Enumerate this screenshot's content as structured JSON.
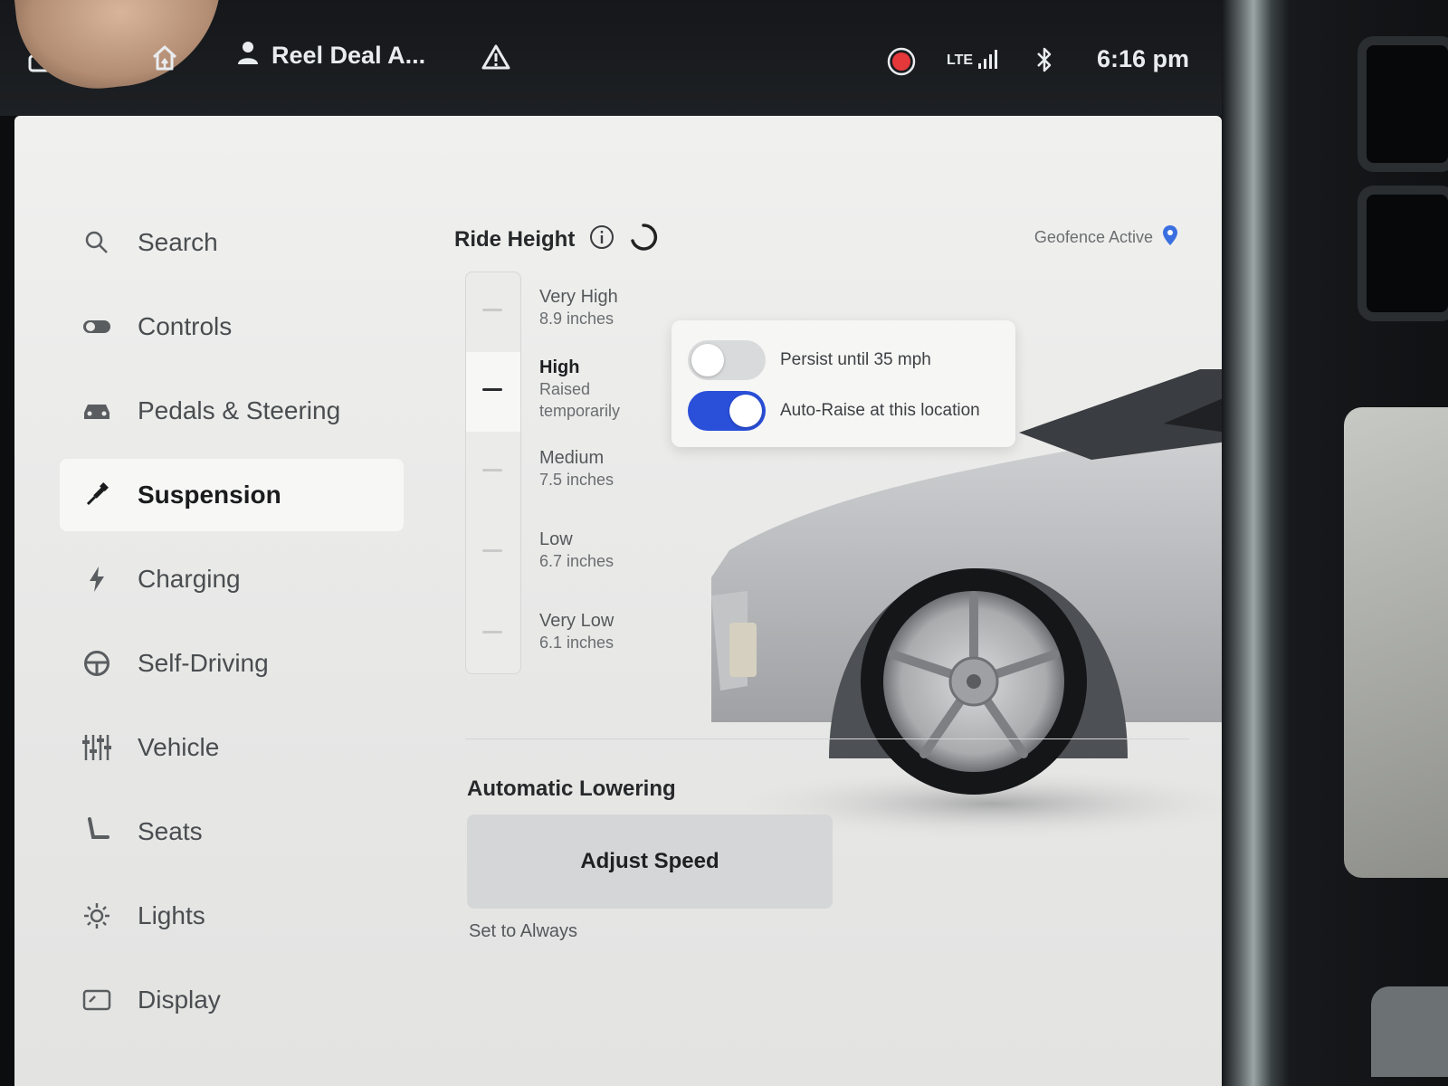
{
  "status_bar": {
    "profile_name": "Reel Deal A...",
    "time": "6:16 pm",
    "network": "LTE"
  },
  "sidebar": {
    "items": [
      {
        "label": "Search",
        "icon": "search-icon"
      },
      {
        "label": "Controls",
        "icon": "toggle-icon"
      },
      {
        "label": "Pedals & Steering",
        "icon": "car-icon"
      },
      {
        "label": "Suspension",
        "icon": "suspension-icon",
        "active": true
      },
      {
        "label": "Charging",
        "icon": "bolt-icon"
      },
      {
        "label": "Self-Driving",
        "icon": "steering-wheel-icon"
      },
      {
        "label": "Vehicle",
        "icon": "sliders-icon"
      },
      {
        "label": "Seats",
        "icon": "seat-icon"
      },
      {
        "label": "Lights",
        "icon": "sun-icon"
      },
      {
        "label": "Display",
        "icon": "display-icon"
      }
    ]
  },
  "ride_height": {
    "title": "Ride Height",
    "geofence_label": "Geofence Active",
    "levels": [
      {
        "name": "Very High",
        "detail": "8.9 inches"
      },
      {
        "name": "High",
        "detail": "Raised",
        "detail2": "temporarily",
        "selected": true
      },
      {
        "name": "Medium",
        "detail": "7.5 inches"
      },
      {
        "name": "Low",
        "detail": "6.7 inches"
      },
      {
        "name": "Very Low",
        "detail": "6.1 inches"
      }
    ]
  },
  "popover": {
    "persist_label": "Persist until 35 mph",
    "persist_on": false,
    "auto_raise_label": "Auto-Raise at this location",
    "auto_raise_on": true
  },
  "automatic_lowering": {
    "title": "Automatic Lowering",
    "button_label": "Adjust Speed",
    "subtitle": "Set to Always"
  },
  "colors": {
    "accent": "#2a4fd9",
    "recording": "#e5383b",
    "geofence_pin": "#3b6fe0"
  }
}
